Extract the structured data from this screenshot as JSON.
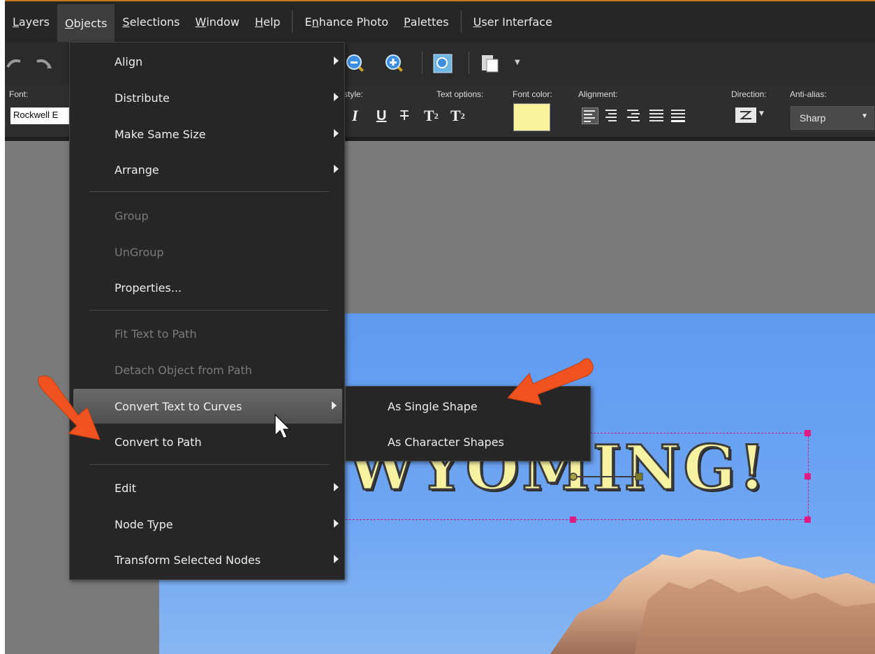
{
  "menubar": {
    "items": [
      {
        "label": "Layers",
        "key": "L",
        "rest": "ayers"
      },
      {
        "label": "Objects",
        "key": "O",
        "rest": "bjects"
      },
      {
        "label": "Selections",
        "key": "S",
        "rest": "elections"
      },
      {
        "label": "Window",
        "key": "W",
        "rest": "indow"
      },
      {
        "label": "Help",
        "key": "H",
        "rest": "elp"
      },
      {
        "label": "Enhance Photo",
        "pre": "E",
        "key": "n",
        "rest": "hance Photo"
      },
      {
        "label": "Palettes",
        "key": "P",
        "rest": "alettes"
      },
      {
        "label": "User Interface",
        "key": "U",
        "rest": "ser Interface"
      }
    ],
    "accent": "#c9761a"
  },
  "toolbar": {
    "icons": [
      "undo-icon",
      "redo-icon",
      "zoom-out-icon",
      "zoom-in-icon",
      "zoom-fit-icon",
      "paste-icon"
    ]
  },
  "text_options": {
    "font_label": "Font:",
    "font_value": "Rockwell E",
    "style_label": "style:",
    "text_options_label": "Text options:",
    "font_color_label": "Font color:",
    "alignment_label": "Alignment:",
    "direction_label": "Direction:",
    "antialias_label": "Anti-alias:",
    "antialias_value": "Sharp",
    "font_color": "#f8f29d",
    "italic": "I",
    "underline": "U",
    "strike": "T",
    "superscript": "T",
    "superscript_mark": "2",
    "subscript": "T",
    "subscript_mark": "2"
  },
  "canvas": {
    "text": "WYOMING!",
    "text_color": "#f7f2a2",
    "selection_color": "#e01b84"
  },
  "objects_menu": {
    "items": [
      {
        "label": "Align",
        "submenu": true,
        "enabled": true
      },
      {
        "label": "Distribute",
        "submenu": true,
        "enabled": true
      },
      {
        "label": "Make Same Size",
        "submenu": true,
        "enabled": true
      },
      {
        "label": "Arrange",
        "submenu": true,
        "enabled": true
      },
      {
        "label": "Group",
        "submenu": false,
        "enabled": false
      },
      {
        "label": "UnGroup",
        "submenu": false,
        "enabled": false
      },
      {
        "label": "Properties...",
        "submenu": false,
        "enabled": true
      },
      {
        "label": "Fit Text to Path",
        "submenu": false,
        "enabled": false
      },
      {
        "label": "Detach Object from Path",
        "submenu": false,
        "enabled": false
      },
      {
        "label": "Convert Text to Curves",
        "submenu": true,
        "enabled": true,
        "highlighted": true
      },
      {
        "label": "Convert to Path",
        "submenu": false,
        "enabled": true
      },
      {
        "label": "Edit",
        "submenu": true,
        "enabled": true
      },
      {
        "label": "Node Type",
        "submenu": true,
        "enabled": true
      },
      {
        "label": "Transform Selected Nodes",
        "submenu": true,
        "enabled": true
      }
    ]
  },
  "convert_submenu": {
    "items": [
      {
        "label": "As Single Shape"
      },
      {
        "label": "As Character Shapes"
      }
    ]
  },
  "annotations": {
    "arrow_color": "#f0531f"
  }
}
